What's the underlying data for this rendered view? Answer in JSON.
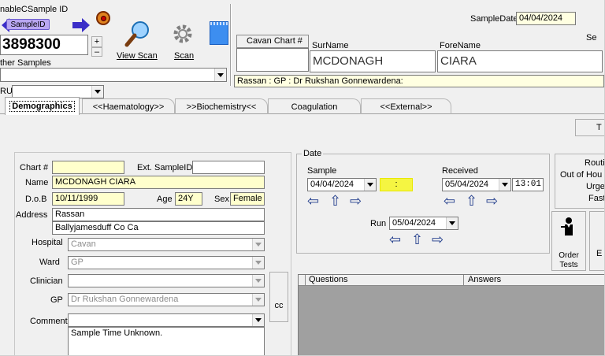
{
  "header": {
    "enable_sample_id_label": "nableCSample ID",
    "sample_id_button": "SampleID",
    "sample_number": "3898300",
    "other_samples_label": "ther Samples",
    "view_scan_label": "View Scan",
    "scan_label": "Scan",
    "ru_label": "RU",
    "sample_date_label": "SampleDate",
    "sample_date_value": "04/04/2024",
    "se_label": "Se",
    "chart_tab_label": "Cavan Chart #",
    "surname_label": "SurName",
    "surname_value": "MCDONAGH",
    "forename_label": "ForeName",
    "forename_value": "CIARA",
    "gp_info": "Rassan : GP : Dr Rukshan Gonnewardena:"
  },
  "tabs": [
    "Demographics",
    "<<Haematology>>",
    ">>Biochemistry<<",
    "Coagulation",
    "<<External>>"
  ],
  "right_tab_fragment": "T",
  "demographics": {
    "chart_label": "Chart #",
    "chart_value": "",
    "ext_sample_id_label": "Ext. SampleID",
    "ext_sample_id_value": "",
    "name_label": "Name",
    "name_value": "MCDONAGH CIARA",
    "dob_label": "D.o.B",
    "dob_value": "10/11/1999",
    "age_label": "Age",
    "age_value": "24Y",
    "sex_label": "Sex",
    "sex_value": "Female",
    "address_label": "Address",
    "address_line1": "Rassan",
    "address_line2": "Ballyjamesduff Co Ca",
    "hospital_label": "Hospital",
    "hospital_value": "Cavan",
    "ward_label": "Ward",
    "ward_value": "GP",
    "clinician_label": "Clinician",
    "clinician_value": "",
    "gp_label": "GP",
    "gp_value": "Dr Rukshan Gonnewardena",
    "cc_label": "cc",
    "comment_label": "Comment",
    "comment_value": "",
    "comment_text": "Sample Time Unknown."
  },
  "date_panel": {
    "title": "Date",
    "sample_label": "Sample",
    "sample_date": "04/04/2024",
    "sample_time": ":",
    "received_label": "Received",
    "received_date": "05/04/2024",
    "received_time": "13:01",
    "run_label": "Run",
    "run_date": "05/04/2024"
  },
  "right_panel": {
    "lines": [
      "Routi",
      "Out of Hou",
      "Urge",
      "Fasti"
    ],
    "order_tests_label": "Order Tests",
    "e_fragment": "E"
  },
  "questions_table": {
    "columns": [
      "Questions",
      "Answers"
    ]
  }
}
